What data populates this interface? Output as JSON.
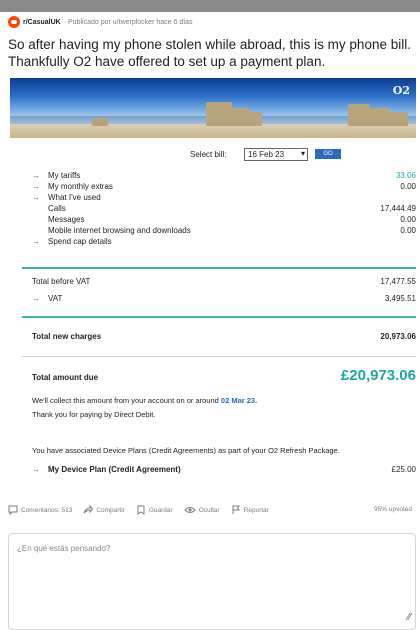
{
  "post": {
    "subreddit": "r/CasualUK",
    "published_prefix": "· Publicado por",
    "author": "u/twerplocker",
    "time": "hace 6 días",
    "title": "So after having my phone stolen while abroad, this is my phone bill. Thankfully O2 have offered to set up a payment plan."
  },
  "bill": {
    "brand": "O2",
    "select_label": "Select bill:",
    "selected_bill": "16 Feb 23",
    "go_label": "GO",
    "lines": [
      {
        "label": "My tariffs",
        "amount": "33.06",
        "arrow": true
      },
      {
        "label": "My monthly extras",
        "amount": "0.00",
        "arrow": true
      },
      {
        "label": "What I've used",
        "amount": "",
        "arrow": true
      },
      {
        "label": "Calls",
        "amount": "17,444.49",
        "arrow": false
      },
      {
        "label": "Messages",
        "amount": "0.00",
        "arrow": false
      },
      {
        "label": "Mobile internet browsing and downloads",
        "amount": "0.00",
        "arrow": false
      },
      {
        "label": "Spend cap details",
        "amount": "",
        "arrow": true
      }
    ],
    "total_before_vat_label": "Total before VAT",
    "total_before_vat": "17,477.55",
    "vat_label": "VAT",
    "vat": "3,495.51",
    "total_new_charges_label": "Total new charges",
    "total_new_charges": "20,973.06",
    "total_due_label": "Total amount due",
    "total_due": "£20,973.06",
    "collect_text_before": "We'll collect this amount from your account on or around",
    "collect_date": "02 Mar 23.",
    "thanks_text": "Thank you for paying by Direct Debit.",
    "device_plan_note": "You have associated Device Plans (Credit Agreements) as part of your O2 Refresh Package.",
    "device_plan_label": "My Device Plan (Credit Agreement)",
    "device_plan_amount": "£25.00"
  },
  "actions": {
    "comments": "Comentarios: 513",
    "share": "Compartir",
    "save": "Guardar",
    "hide": "Ocultar",
    "report": "Reportar",
    "upvoted": "95% upvoted"
  },
  "comment": {
    "placeholder": "¿En qué estás pensando?"
  }
}
